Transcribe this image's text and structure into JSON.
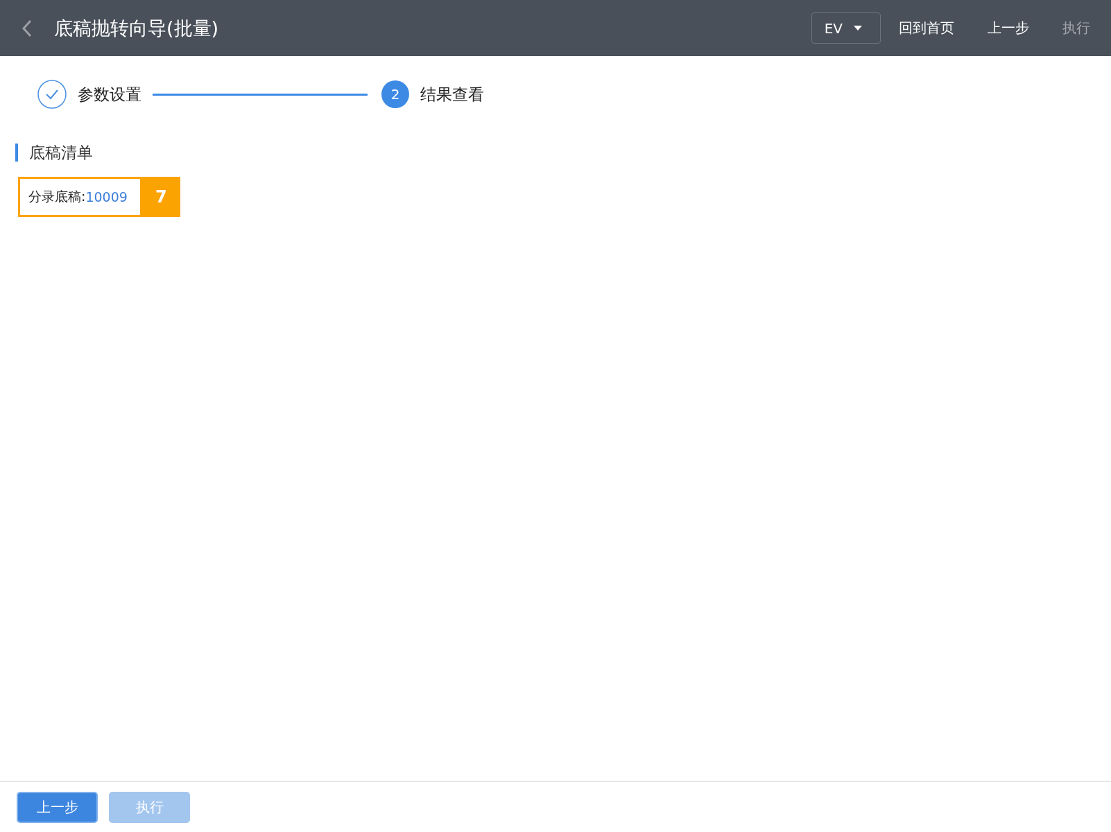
{
  "header": {
    "title": "底稿抛转向导(批量)",
    "dropdown": {
      "value": "EV"
    },
    "actions": [
      {
        "label": "回到首页",
        "disabled": false
      },
      {
        "label": "上一步",
        "disabled": false
      },
      {
        "label": "执行",
        "disabled": true
      }
    ]
  },
  "steps": [
    {
      "label": "参数设置",
      "done": true,
      "selected": false
    },
    {
      "label": "结果查看",
      "number": "2",
      "done": false,
      "selected": true
    }
  ],
  "section": {
    "title": "底稿清单",
    "items": [
      {
        "label": "分录底稿:",
        "value": "10009",
        "badge": "7",
        "highlighted": true
      }
    ]
  },
  "footer": {
    "buttons": [
      {
        "label": "上一步",
        "disabled": false
      },
      {
        "label": "执行",
        "disabled": true
      }
    ]
  }
}
